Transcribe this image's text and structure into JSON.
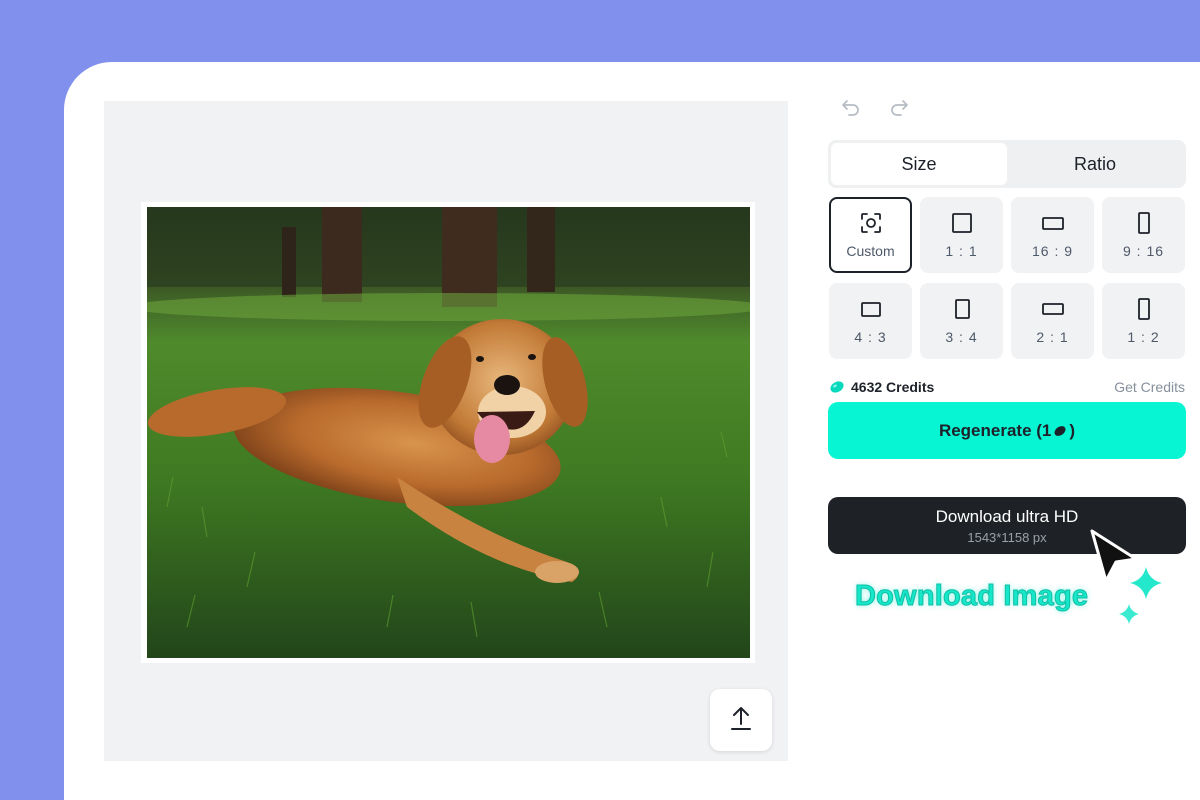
{
  "colors": {
    "background": "#8090ec",
    "accent": "#08f5d3",
    "dark_button": "#1e2227",
    "caption": "#17e7c9"
  },
  "toolbar": {
    "undo_icon": "undo-icon",
    "redo_icon": "redo-icon"
  },
  "tabs": [
    {
      "label": "Size",
      "active": true
    },
    {
      "label": "Ratio",
      "active": false
    }
  ],
  "ratios": [
    {
      "label": "Custom",
      "icon": "custom-focus-icon",
      "selected": true
    },
    {
      "label": "1 : 1",
      "icon": "square-icon"
    },
    {
      "label": "16 : 9",
      "icon": "landscape-wide-icon"
    },
    {
      "label": "9 : 16",
      "icon": "portrait-tall-icon"
    },
    {
      "label": "4 : 3",
      "icon": "landscape-icon"
    },
    {
      "label": "3 : 4",
      "icon": "portrait-icon"
    },
    {
      "label": "2 : 1",
      "icon": "landscape-wide-icon"
    },
    {
      "label": "1 : 2",
      "icon": "portrait-tall-icon"
    }
  ],
  "credits": {
    "amount_label": "4632 Credits",
    "get_label": "Get Credits"
  },
  "regenerate": {
    "label_prefix": "Regenerate (1",
    "label_suffix": ")"
  },
  "download": {
    "title": "Download ultra HD",
    "resolution": "1543*1158 px"
  },
  "caption": "Download Image",
  "upload_icon": "upload-icon"
}
